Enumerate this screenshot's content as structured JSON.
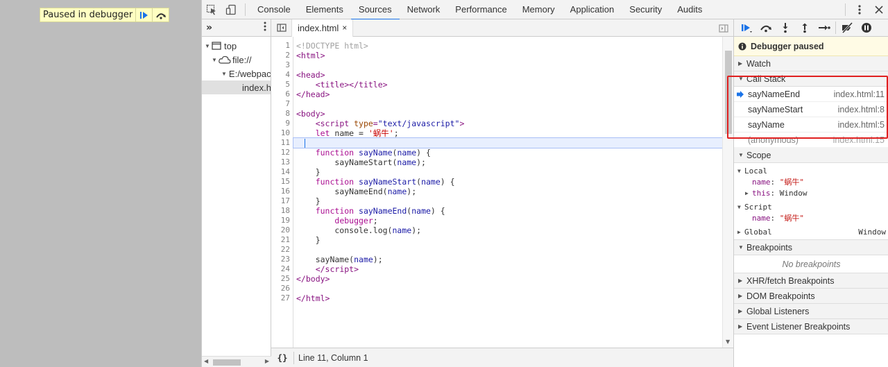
{
  "page": {
    "overlay_label": "Paused in debugger"
  },
  "toolbar": {
    "tabs": [
      "Console",
      "Elements",
      "Sources",
      "Network",
      "Performance",
      "Memory",
      "Application",
      "Security",
      "Audits"
    ],
    "active_tab": "Sources"
  },
  "navigator": {
    "items": [
      {
        "label": "top"
      },
      {
        "label": "file://"
      },
      {
        "label": "E:/webpack"
      },
      {
        "label": "index.html"
      }
    ]
  },
  "editor": {
    "file_tab": "index.html",
    "close_glyph": "×",
    "line_numbers": [
      "1",
      "2",
      "3",
      "4",
      "5",
      "6",
      "7",
      "8",
      "9",
      "10",
      "11",
      "12",
      "13",
      "14",
      "15",
      "16",
      "17",
      "18",
      "19",
      "20",
      "21",
      "22",
      "23",
      "24",
      "25",
      "26",
      "27"
    ],
    "status": "Line 11, Column 1",
    "format_label": "{}"
  },
  "sidebar": {
    "paused_message": "Debugger paused",
    "sections": {
      "watch": "Watch",
      "call_stack": "Call Stack",
      "scope": "Scope",
      "breakpoints": "Breakpoints",
      "xhr": "XHR/fetch Breakpoints",
      "dom": "DOM Breakpoints",
      "global_listeners": "Global Listeners",
      "event_listeners": "Event Listener Breakpoints"
    },
    "call_stack": [
      {
        "name": "sayNameEnd",
        "location": "index.html:11"
      },
      {
        "name": "sayNameStart",
        "location": "index.html:8"
      },
      {
        "name": "sayName",
        "location": "index.html:5"
      },
      {
        "name": "(anonymous)",
        "location": "index.html:15"
      }
    ],
    "scope": {
      "local_label": "Local",
      "local_name_key": "name",
      "local_name_value": "\"蜗牛\"",
      "local_this_key": "this",
      "local_this_value": "Window",
      "script_label": "Script",
      "script_name_key": "name",
      "script_name_value": "\"蜗牛\"",
      "global_label": "Global",
      "global_value": "Window"
    },
    "no_breakpoints": "No breakpoints"
  },
  "colors": {
    "accent": "#1a73e8",
    "highlight_box": "#e02020",
    "paused_bg": "#fffbe5"
  }
}
